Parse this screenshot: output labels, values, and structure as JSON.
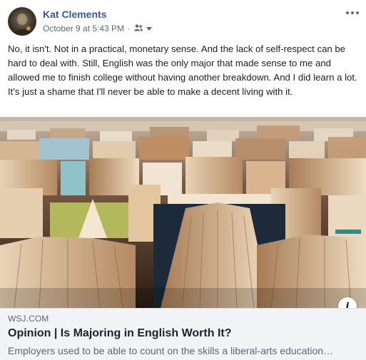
{
  "post": {
    "author": "Kat Clements",
    "timestamp": "October 9 at 5:43 PM",
    "separator": "·",
    "audience_icon": "friends-icon",
    "dropdown_icon": "caret-down-icon",
    "more_icon": "more-options-icon",
    "body": "No, it isn't. Not in a practical, monetary sense. And the lack of self-respect can be hard to deal with. Still, English was the only major that made sense to me and allowed me to finish college without having another breakdown. And I did learn a lot. It's just a shame that I'll never be able to make a decent living with it."
  },
  "link_preview": {
    "image": "rows-of-open-books-photo",
    "info_label": "i",
    "domain": "WSJ.COM",
    "title": "Opinion | Is Majoring in English Worth It?",
    "description": "Employers used to be able to count on the skills a liberal-arts education…"
  },
  "colors": {
    "author_link": "#385898",
    "secondary_text": "#606770",
    "preview_bg": "#f2f3f5"
  }
}
